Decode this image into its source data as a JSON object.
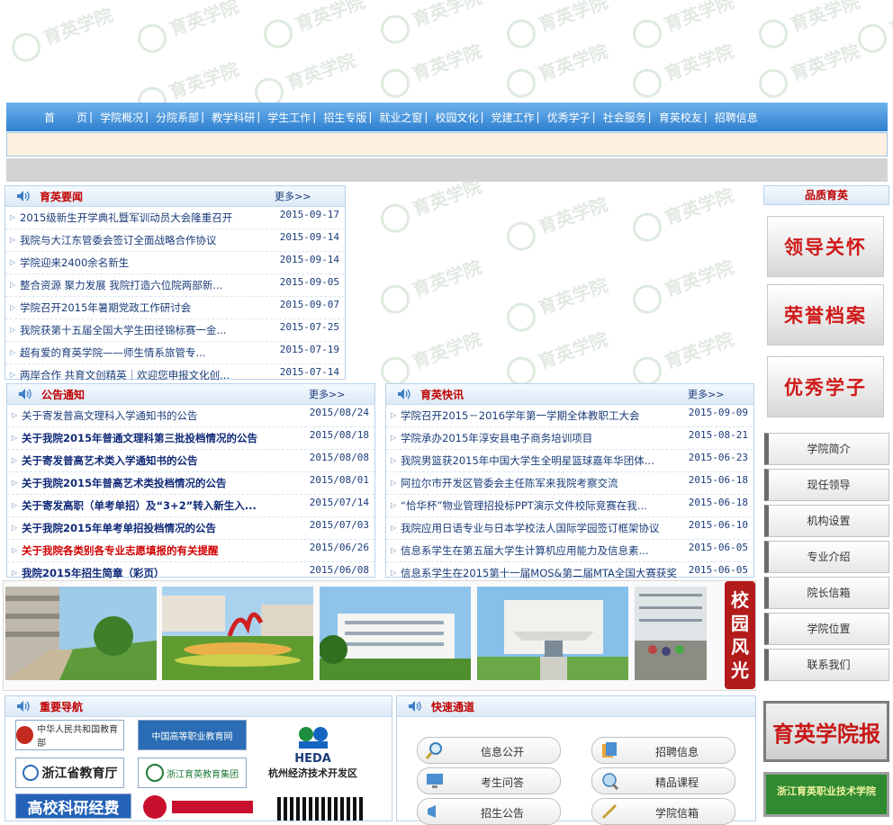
{
  "watermark": {
    "text": "育英学院",
    "sub": "YUYING COLLEGE"
  },
  "nav": {
    "items": [
      "首　　页",
      "学院概况",
      "分院系部",
      "教学科研",
      "学生工作",
      "招生专版",
      "就业之窗",
      "校园文化",
      "党建工作",
      "优秀学子",
      "社会服务",
      "育英校友",
      "招聘信息"
    ],
    "separator": "|"
  },
  "news": {
    "title": "育英要闻",
    "more": "更多>>",
    "items": [
      {
        "text": "2015级新生开学典礼暨军训动员大会隆重召开",
        "date": "2015-09-17"
      },
      {
        "text": "我院与大江东管委会签订全面战略合作协议",
        "date": "2015-09-14"
      },
      {
        "text": "学院迎来2400余名新生",
        "date": "2015-09-14"
      },
      {
        "text": "整合资源 聚力发展 我院打造六位院两部新...",
        "date": "2015-09-05"
      },
      {
        "text": "学院召开2015年暑期党政工作研讨会",
        "date": "2015-09-07"
      },
      {
        "text": "我院获第十五届全国大学生田径锦标赛一金...",
        "date": "2015-07-25"
      },
      {
        "text": "超有爱的育英学院——师生情系旅管专...",
        "date": "2015-07-19"
      },
      {
        "text": "两岸合作 共育文创精英｜欢迎您申报文化创...",
        "date": "2015-07-14"
      }
    ]
  },
  "notices": {
    "title": "公告通知",
    "more": "更多>>",
    "items": [
      {
        "text": "关于寄发普高文理科入学通知书的公告",
        "date": "2015/08/24",
        "style": "normal"
      },
      {
        "text": "关于我院2015年普通文理科第三批投档情况的公告",
        "date": "2015/08/18",
        "style": "bold"
      },
      {
        "text": "关于寄发普高艺术类入学通知书的公告",
        "date": "2015/08/08",
        "style": "bold"
      },
      {
        "text": "关于我院2015年普高艺术类投档情况的公告",
        "date": "2015/08/01",
        "style": "bold"
      },
      {
        "text": "关于寄发高职（单考单招）及“3+2”转入新生入...",
        "date": "2015/07/14",
        "style": "bold"
      },
      {
        "text": "关于我院2015年单考单招投档情况的公告",
        "date": "2015/07/03",
        "style": "bold"
      },
      {
        "text": "关于我院各类别各专业志愿填报的有关提醒",
        "date": "2015/06/26",
        "style": "red"
      },
      {
        "text": "我院2015年招生简章（彩页）",
        "date": "2015/06/08",
        "style": "bold"
      }
    ]
  },
  "flash": {
    "title": "育英快讯",
    "more": "更多>>",
    "items": [
      {
        "text": "学院召开2015－2016学年第一学期全体教职工大会",
        "date": "2015-09-09"
      },
      {
        "text": "学院承办2015年淳安县电子商务培训项目",
        "date": "2015-08-21"
      },
      {
        "text": "我院男篮获2015年中国大学生全明星篮球嘉年华团体...",
        "date": "2015-06-23"
      },
      {
        "text": "阿拉尔市开发区管委会主任陈军来我院考察交流",
        "date": "2015-06-18"
      },
      {
        "text": "“恰华杯”物业管理招投标PPT演示文件校际竞赛在我...",
        "date": "2015-06-18"
      },
      {
        "text": "我院应用日语专业与日本学校法人国际学园签订框架协议",
        "date": "2015-06-10"
      },
      {
        "text": "信息系学生在第五届大学生计算机应用能力及信息素...",
        "date": "2015-06-05"
      },
      {
        "text": "信息系学生在2015第十一届MOS&第二届MTA全国大赛获奖",
        "date": "2015-06-05"
      }
    ]
  },
  "quality": {
    "title": "品质育英",
    "features": [
      "领导关怀",
      "荣誉档案",
      "优秀学子"
    ]
  },
  "side_links": [
    "学院简介",
    "现任领导",
    "机构设置",
    "专业介绍",
    "院长信箱",
    "学院位置",
    "联系我们"
  ],
  "banners": {
    "newspaper": "育英学院报",
    "green": "浙江育英职业技术学院"
  },
  "campus": {
    "label": [
      "校",
      "园",
      "风",
      "光"
    ]
  },
  "nav_links": {
    "title": "重要导航",
    "logos": [
      {
        "text": "中华人民共和国教育部"
      },
      {
        "text": "中国高等职业教育网"
      },
      {
        "text": "HEDA",
        "sub": "杭州经济技术开发区"
      },
      {
        "text": "浙江省教育厅"
      },
      {
        "text": "浙江育英教育集团"
      },
      {
        "text": "高校科研经费"
      }
    ]
  },
  "quick": {
    "title": "快速通道",
    "buttons": [
      "信息公开",
      "招聘信息",
      "考生问答",
      "精品课程",
      "招生公告",
      "学院信箱"
    ]
  },
  "colors": {
    "nav_top": "#6eb3ec",
    "nav_bottom": "#2e7fd0",
    "title_red": "#c00000",
    "link_blue": "#1a3c7a"
  }
}
